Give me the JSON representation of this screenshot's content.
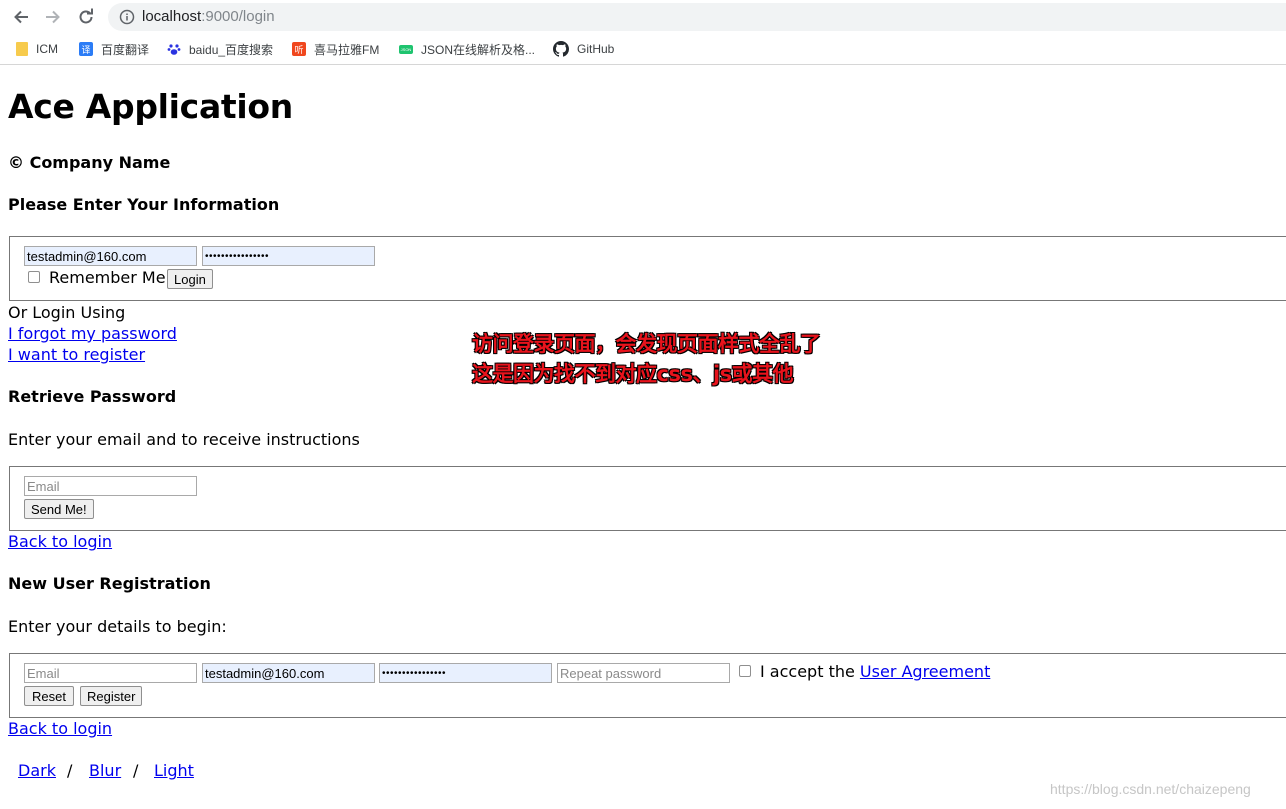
{
  "browser": {
    "url_host": "localhost",
    "url_path": ":9000/login",
    "bookmarks": [
      {
        "label": "ICM",
        "icon": "folder-icon",
        "color": "#f7cb4d"
      },
      {
        "label": "百度翻译",
        "icon": "translate-icon",
        "icon_text": "译",
        "color": "#2b7cf6"
      },
      {
        "label": "baidu_百度搜索",
        "icon": "baidu-paw-icon",
        "color": "#2932e1"
      },
      {
        "label": "喜马拉雅FM",
        "icon": "ximalaya-icon",
        "icon_text": "听",
        "color": "#f0471e"
      },
      {
        "label": "JSON在线解析及格...",
        "icon": "json-icon",
        "icon_text": "JSON",
        "color": "#1fc46f"
      },
      {
        "label": "GitHub",
        "icon": "github-icon",
        "color": "#24292e"
      }
    ]
  },
  "page": {
    "title": "Ace Application",
    "company": "© Company Name",
    "login": {
      "heading": "Please Enter Your Information",
      "username_value": "testadmin@160.com",
      "password_value": "••••••••••••••••",
      "remember_label": "Remember Me",
      "login_button": "Login",
      "or_login": "Or Login Using",
      "forgot_link": "I forgot my password",
      "register_link": "I want to register"
    },
    "retrieve": {
      "heading": "Retrieve Password",
      "instructions": "Enter your email and to receive instructions",
      "email_placeholder": "Email",
      "send_button": "Send Me!",
      "back_link": "Back to login"
    },
    "register": {
      "heading": "New User Registration",
      "instructions": "Enter your details to begin:",
      "email_placeholder": "Email",
      "username_value": "testadmin@160.com",
      "password_value": "••••••••••••••••",
      "repeat_placeholder": "Repeat password",
      "accept_label": "I accept the",
      "agreement_link": "User Agreement",
      "reset_button": "Reset",
      "register_button": "Register",
      "back_link": "Back to login"
    },
    "themes": {
      "dark": "Dark",
      "blur": "Blur",
      "light": "Light",
      "separator": "/"
    }
  },
  "annotation": {
    "line1": "访问登录页面，会发现页面样式全乱了",
    "line2": "这是因为找不到对应css、js或其他"
  },
  "watermark": "https://blog.csdn.net/chaizepeng"
}
